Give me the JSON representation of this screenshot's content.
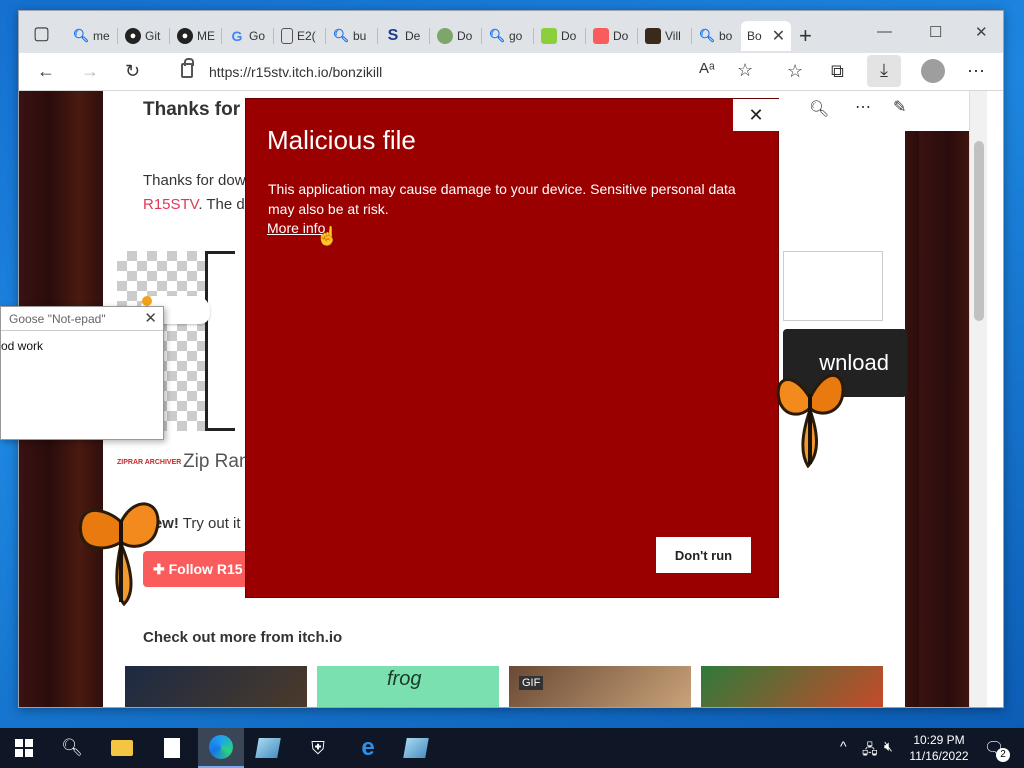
{
  "browser": {
    "tabs": [
      {
        "label": "me",
        "icon": "search-icon"
      },
      {
        "label": "Git",
        "icon": "github-icon"
      },
      {
        "label": "ME",
        "icon": "github-icon"
      },
      {
        "label": "Go",
        "icon": "google-icon"
      },
      {
        "label": "E2(",
        "icon": "document-icon"
      },
      {
        "label": "bu",
        "icon": "search-icon"
      },
      {
        "label": "De",
        "icon": "s-logo-icon"
      },
      {
        "label": "Do",
        "icon": "frog-icon"
      },
      {
        "label": "go",
        "icon": "search-icon"
      },
      {
        "label": "Do",
        "icon": "green-icon"
      },
      {
        "label": "Do",
        "icon": "itch-icon"
      },
      {
        "label": "Vill",
        "icon": "game-icon"
      },
      {
        "label": "bo",
        "icon": "search-icon"
      },
      {
        "label": "Bo",
        "icon": "active-tab"
      }
    ],
    "url": "https://r15stv.itch.io/bonzikill"
  },
  "page": {
    "heading": "Thanks for d",
    "para_line1": "Thanks for dow",
    "link": "R15STV",
    "para_line2_rest": ". The do",
    "zip_logo": "ZIPRAR ARCHIVER",
    "zip_label": "Zip Ran",
    "new_bold": "New!",
    "new_rest": " Try out it",
    "follow_label": "✚ Follow R15",
    "download_label": "wnload",
    "more_title": "Check out more from itch.io",
    "thumb_gif": "GIF",
    "thumb_frog": "frog"
  },
  "goose": {
    "title": "Goose \"Not-epad\"",
    "text": "od work"
  },
  "dialog": {
    "title": "Malicious file",
    "message": "This application may cause damage to your device. Sensitive personal data may also be at risk.",
    "more_info": "More info",
    "dont_run": "Don't run"
  },
  "taskbar": {
    "time": "10:29 PM",
    "date": "11/16/2022",
    "notifications": "2"
  },
  "colors": {
    "dialog_bg": "#9b0000",
    "accent_link": "#e0365a",
    "follow_btn": "#fa5c5c"
  }
}
